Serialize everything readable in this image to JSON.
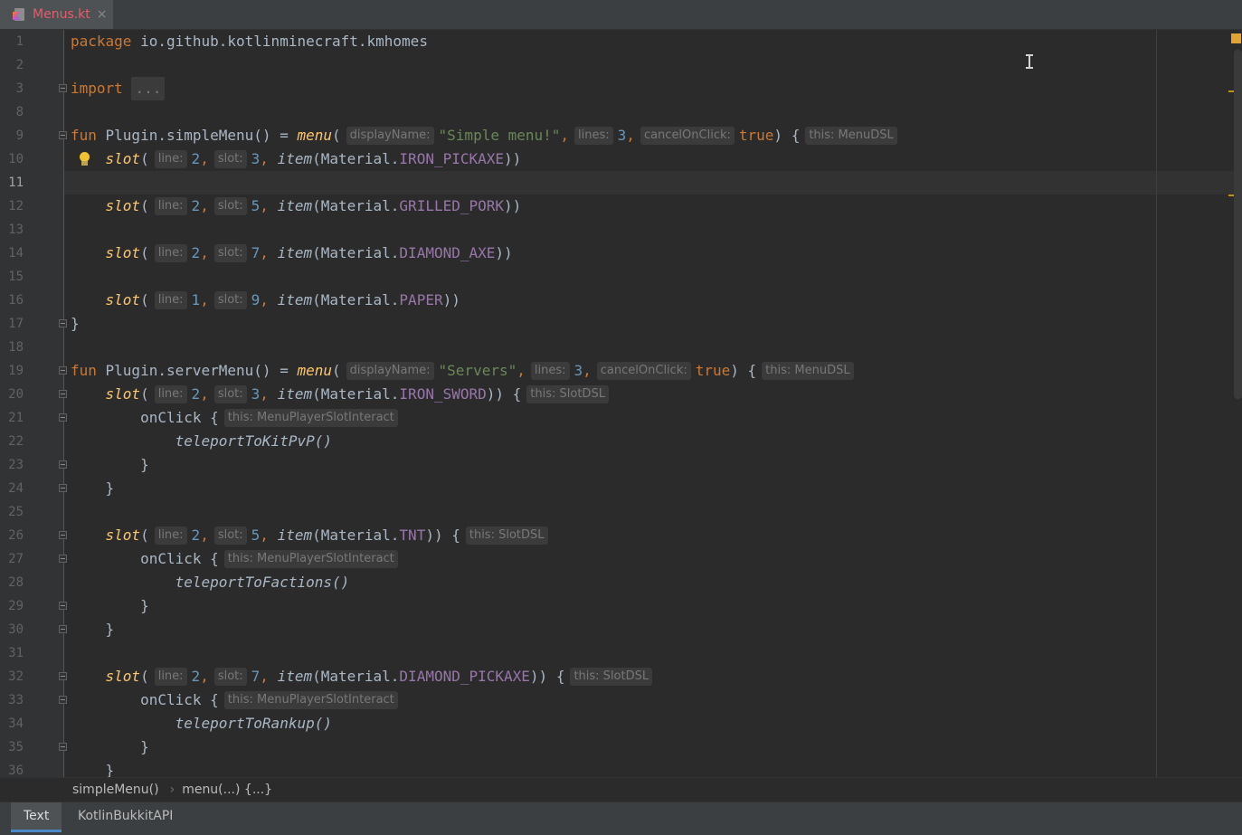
{
  "tab": {
    "file_name": "Menus.kt",
    "close_glyph": "×",
    "icon": "kotlin-file-icon"
  },
  "editor": {
    "lines": [
      "1",
      "2",
      "3",
      "8",
      "9",
      "10",
      "11",
      "12",
      "13",
      "14",
      "15",
      "16",
      "17",
      "18",
      "19",
      "20",
      "21",
      "22",
      "23",
      "24",
      "25",
      "26",
      "27",
      "28",
      "29",
      "30",
      "31",
      "32",
      "33",
      "34",
      "35",
      "36"
    ],
    "active_line": "11",
    "package_kw": "package",
    "package_name": "io.github.kotlinminecraft.kmhomes",
    "import_kw": "import",
    "import_fold": "...",
    "fun_kw": "fun",
    "hints": {
      "displayName": "displayName:",
      "lines": "lines:",
      "cancelOnClick": "cancelOnClick:",
      "line": "line:",
      "slot": "slot:",
      "this_menu": "this: MenuDSL",
      "this_slot": "this: SlotDSL",
      "this_interact": "this: MenuPlayerSlotInteract"
    },
    "simple_menu": {
      "receiver": "Plugin.simpleMenu() = ",
      "call": "menu",
      "title": "\"Simple menu!\"",
      "lines": "3",
      "cancel": "true",
      "slots": [
        {
          "line": "2",
          "slot": "3",
          "material": "IRON_PICKAXE"
        },
        {
          "line": "2",
          "slot": "5",
          "material": "GRILLED_PORK"
        },
        {
          "line": "2",
          "slot": "7",
          "material": "DIAMOND_AXE"
        },
        {
          "line": "1",
          "slot": "9",
          "material": "PAPER"
        }
      ]
    },
    "server_menu": {
      "receiver": "Plugin.serverMenu() = ",
      "call": "menu",
      "title": "\"Servers\"",
      "lines": "3",
      "cancel": "true",
      "slots": [
        {
          "line": "2",
          "slot": "3",
          "material": "IRON_SWORD",
          "action": "teleportToKitPvP"
        },
        {
          "line": "2",
          "slot": "5",
          "material": "TNT",
          "action": "teleportToFactions"
        },
        {
          "line": "2",
          "slot": "7",
          "material": "DIAMOND_PICKAXE",
          "action": "teleportToRankup"
        }
      ]
    },
    "tokens": {
      "slot": "slot",
      "item": "item",
      "material_prefix": "Material.",
      "on_click": "onClick",
      "call_suffix": "()"
    }
  },
  "breadcrumbs": {
    "first": "simpleMenu()",
    "separator": "›",
    "second": "menu(...) {...}"
  },
  "bottom_tabs": [
    "Text",
    "KotlinBukkitAPI"
  ],
  "colors": {
    "keyword": "#cc7832",
    "function": "#ffc66d",
    "string": "#6a8759",
    "number": "#6897bb",
    "field": "#9876aa",
    "tab_text": "#e45d6d"
  }
}
